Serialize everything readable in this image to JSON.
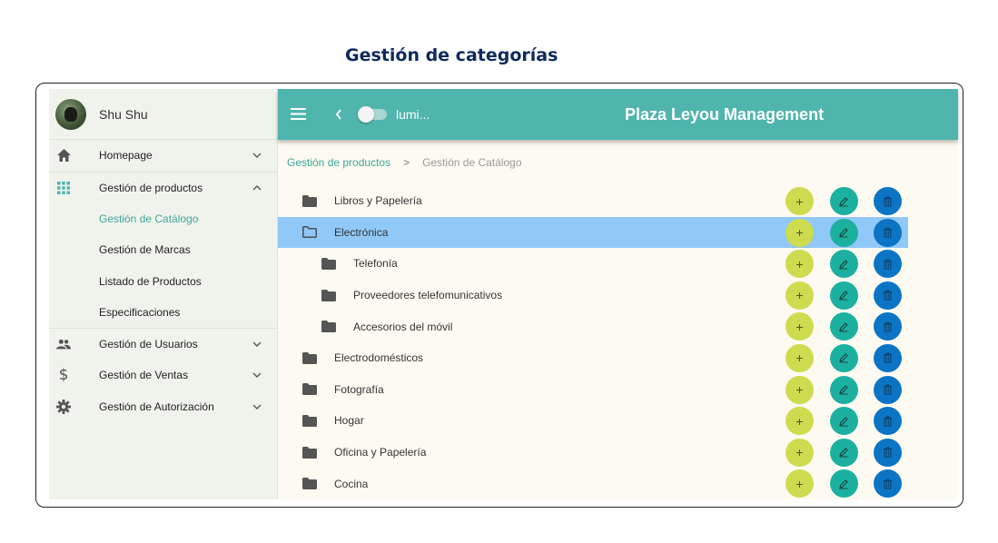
{
  "page_title": "Gestión de categorías",
  "user": {
    "name": "Shu Shu"
  },
  "sidebar": {
    "items": [
      {
        "label": "Homepage",
        "icon": "home-icon",
        "chevron": "down"
      },
      {
        "label": "Gestión de productos",
        "icon": "grid-icon",
        "chevron": "up",
        "children": [
          "Gestión de Catálogo",
          "Gestión de Marcas",
          "Listado de Productos",
          "Especificaciones"
        ]
      },
      {
        "label": "Gestión de Usuarios",
        "icon": "users-icon",
        "chevron": "down"
      },
      {
        "label": "Gestión de Ventas",
        "icon": "dollar-icon",
        "chevron": "down"
      },
      {
        "label": "Gestión de Autorización",
        "icon": "gear-icon",
        "chevron": "down"
      }
    ],
    "active_child": "Gestión de Catálogo"
  },
  "topbar": {
    "theme_label": "lumi...",
    "app_title": "Plaza Leyou Management"
  },
  "breadcrumb": {
    "parent": "Gestión de productos",
    "separator": ">",
    "current": "Gestión de Catálogo"
  },
  "categories": [
    {
      "name": "Libros y Papelería",
      "level": 0,
      "selected": false
    },
    {
      "name": "Electrónica",
      "level": 0,
      "selected": true
    },
    {
      "name": "Telefonía",
      "level": 1,
      "selected": false
    },
    {
      "name": "Proveedores telefomunicativos",
      "level": 1,
      "selected": false
    },
    {
      "name": "Accesorios del móvil",
      "level": 1,
      "selected": false
    },
    {
      "name": "Electrodomésticos",
      "level": 0,
      "selected": false
    },
    {
      "name": "Fotografía",
      "level": 0,
      "selected": false
    },
    {
      "name": "Hogar",
      "level": 0,
      "selected": false
    },
    {
      "name": "Oficina y Papelería",
      "level": 0,
      "selected": false
    },
    {
      "name": "Cocina",
      "level": 0,
      "selected": false
    }
  ],
  "colors": {
    "accent": "#4fb5ad",
    "add": "#cddb4e",
    "edit": "#1cb0a0",
    "delete": "#0c74c4",
    "selected_row": "#90c8f8"
  }
}
